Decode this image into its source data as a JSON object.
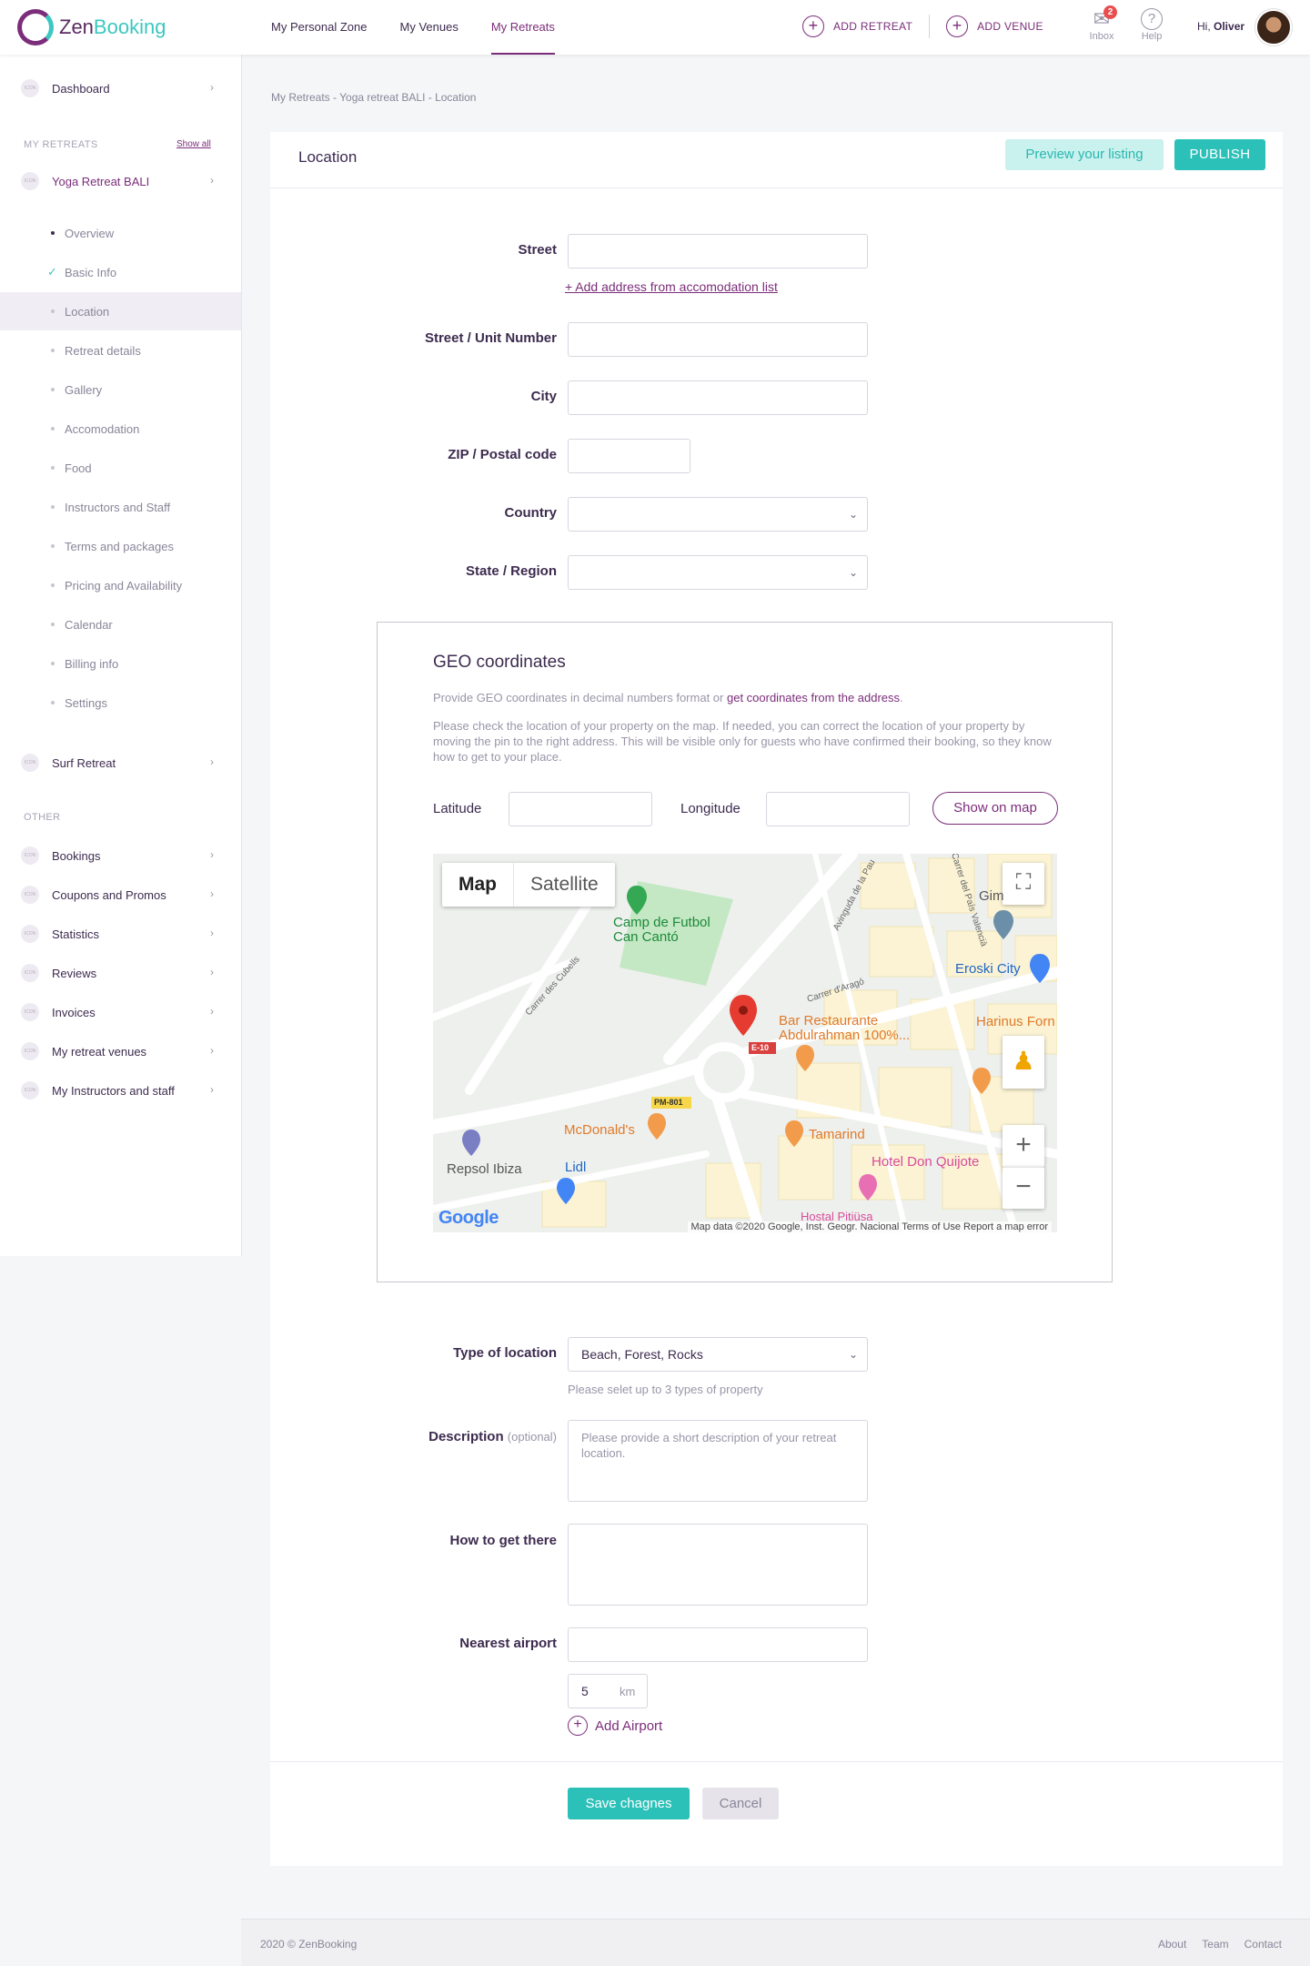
{
  "brand": {
    "name_part1": "Zen",
    "name_part2": "Booking"
  },
  "topnav": {
    "items": [
      "My Personal Zone",
      "My Venues",
      "My Retreats"
    ]
  },
  "top_actions": {
    "add_retreat": "ADD RETREAT",
    "add_venue": "ADD VENUE",
    "inbox_label": "Inbox",
    "inbox_count": "2",
    "help_label": "Help"
  },
  "user": {
    "greeting": "Hi,",
    "name": "Oliver"
  },
  "sidebar": {
    "icon_text": "ICON",
    "dashboard": "Dashboard",
    "my_retreats_heading": "MY RETREATS",
    "show_all": "Show all",
    "current_retreat": "Yoga Retreat BALI",
    "sub_items": [
      "Overview",
      "Basic Info",
      "Location",
      "Retreat details",
      "Gallery",
      "Accomodation",
      "Food",
      "Instructors and Staff",
      "Terms and packages",
      "Pricing and Availability",
      "Calendar",
      "Billing info",
      "Settings"
    ],
    "other_retreat": "Surf Retreat",
    "other_heading": "OTHER",
    "other_items": [
      "Bookings",
      "Coupons and Promos",
      "Statistics",
      "Reviews",
      "Invoices",
      "My retreat venues",
      "My Instructors and staff"
    ]
  },
  "breadcrumb": "My Retreats - Yoga retreat BALI - Location",
  "card": {
    "title": "Location",
    "preview_button": "Preview your listing",
    "publish_button": "PUBLISH"
  },
  "form": {
    "street_label": "Street",
    "add_address_link": "+ Add address from accomodation list",
    "unit_label": "Street / Unit Number",
    "city_label": "City",
    "zip_label": "ZIP / Postal code",
    "country_label": "Country",
    "state_label": "State / Region",
    "type_label": "Type of location",
    "type_value": "Beach, Forest, Rocks",
    "type_hint": "Please selet up to 3 types of property",
    "description_label": "Description",
    "description_optional": "(optional)",
    "description_placeholder": "Please provide a short description of your retreat location.",
    "how_label": "How to get there",
    "airport_label": "Nearest airport",
    "distance_value": "5",
    "distance_unit": "km",
    "add_airport": "Add Airport",
    "save_button": "Save chagnes",
    "cancel_button": "Cancel"
  },
  "geo": {
    "title": "GEO coordinates",
    "text1_prefix": "Provide GEO coordinates in decimal numbers format or",
    "text1_link": "get coordinates from the address",
    "text2": "Please check the location of your property on the map. If needed, you can correct the location of your property by moving the pin to the right address. This will be visible only for guests who have confirmed their booking, so they know how to get to your place.",
    "latitude_label": "Latitude",
    "longitude_label": "Longitude",
    "show_on_map": "Show on map"
  },
  "map": {
    "tab_map": "Map",
    "tab_satellite": "Satellite",
    "places": [
      "Camp de Futbol Can Cantó",
      "Bar Restaurante Abdulrahman 100%...",
      "Eroski City",
      "Harinus Forn",
      "McDonald's",
      "Tamarind",
      "Hotel Don Quijote",
      "Repsol Ibiza",
      "Lidl",
      "Hostal Pitiüsa",
      "Gim"
    ],
    "streets": [
      "Carrer des Cubells",
      "Avinguda de la Pau",
      "Carrer d'Aragó",
      "Carrer del País Valencià"
    ],
    "road_codes": [
      "E-10",
      "PM-801"
    ],
    "google": "Google",
    "footer": "Map data ©2020 Google, Inst. Geogr. Nacional   Terms of Use   Report a map error",
    "colors": {
      "park": "#c5e8c4",
      "road": "#ffffff",
      "blocks": "#fbf3d4",
      "pin": "#e53b30"
    }
  },
  "footer": {
    "copyright": "2020 © ZenBooking",
    "links": [
      "About",
      "Team",
      "Contact"
    ]
  },
  "colors": {
    "accent": "#7b2d7a",
    "teal": "#2bc0b8",
    "text": "#3d2b4f"
  }
}
